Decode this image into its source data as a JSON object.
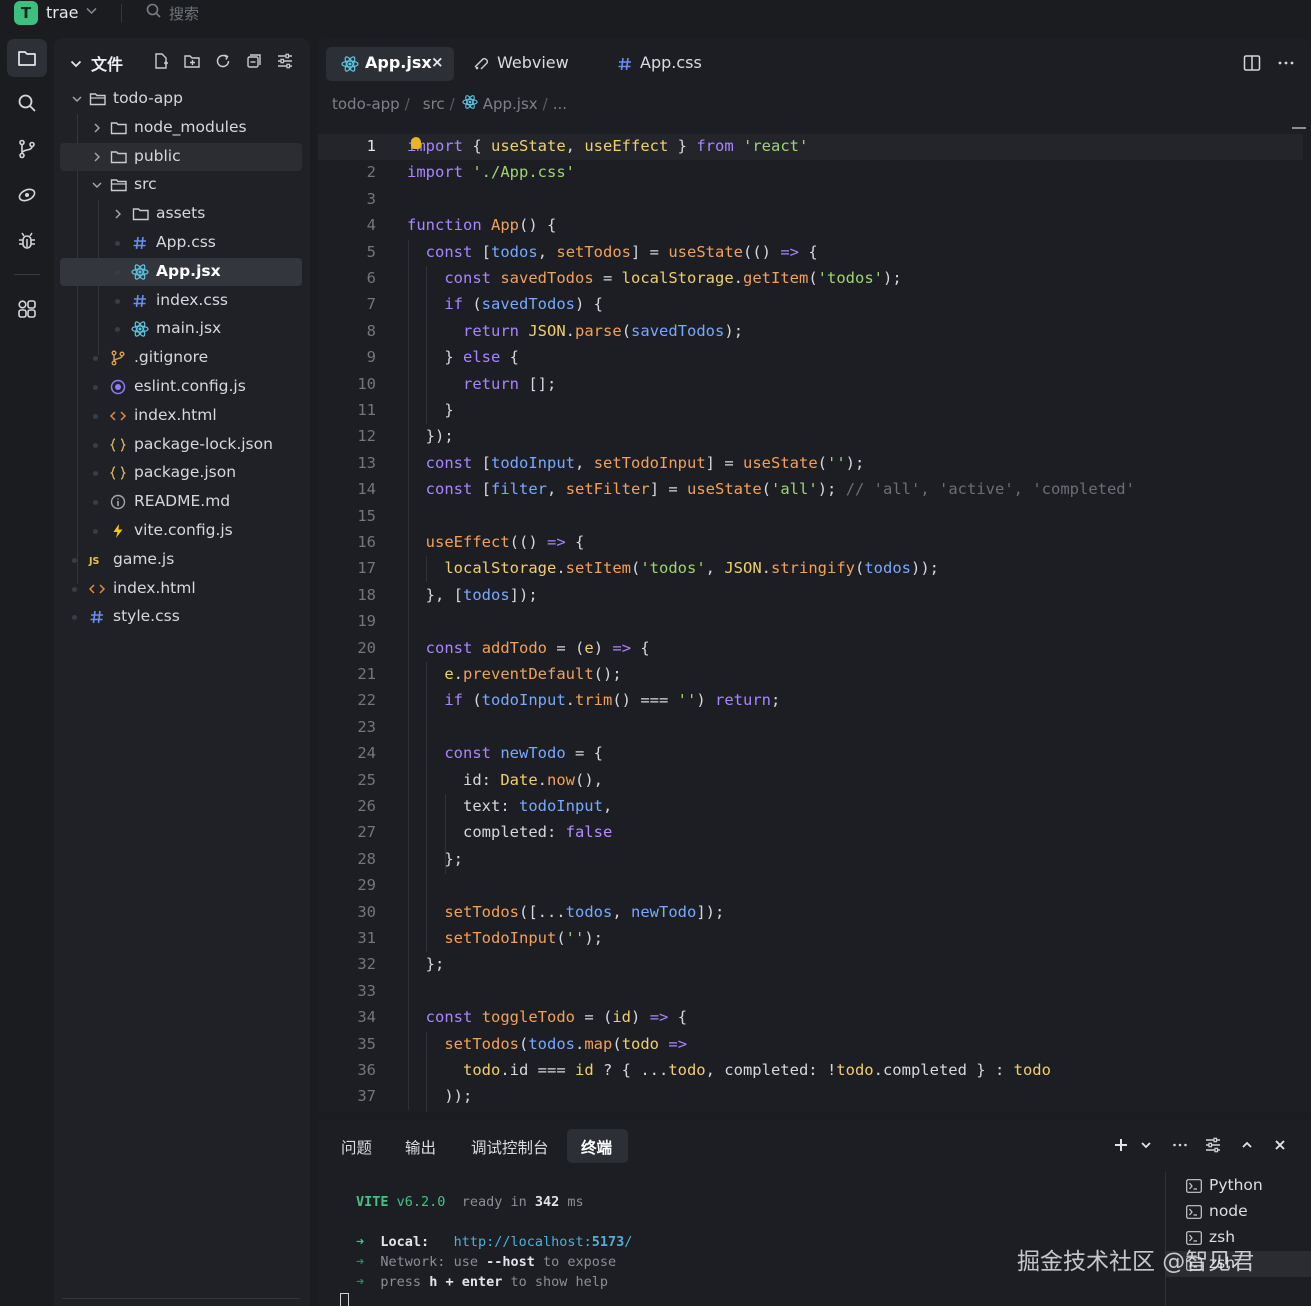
{
  "app": {
    "logo_letter": "T",
    "name": "trae",
    "search_placeholder": "搜索"
  },
  "explorer": {
    "title": "文件",
    "tree": [
      {
        "label": "todo-app",
        "icon": "folder-open-icon"
      },
      {
        "label": "node_modules",
        "icon": "folder-icon"
      },
      {
        "label": "public",
        "icon": "folder-icon"
      },
      {
        "label": "src",
        "icon": "folder-open-icon"
      },
      {
        "label": "assets",
        "icon": "folder-icon"
      },
      {
        "label": "App.css",
        "icon": "css-hash-icon"
      },
      {
        "label": "App.jsx",
        "icon": "react-icon"
      },
      {
        "label": "index.css",
        "icon": "css-hash-icon"
      },
      {
        "label": "main.jsx",
        "icon": "react-icon"
      },
      {
        "label": ".gitignore",
        "icon": "git-icon"
      },
      {
        "label": "eslint.config.js",
        "icon": "eslint-icon"
      },
      {
        "label": "index.html",
        "icon": "html-icon"
      },
      {
        "label": "package-lock.json",
        "icon": "json-icon"
      },
      {
        "label": "package.json",
        "icon": "json-icon"
      },
      {
        "label": "README.md",
        "icon": "info-icon"
      },
      {
        "label": "vite.config.js",
        "icon": "vite-icon"
      },
      {
        "label": "game.js",
        "icon": "js-icon"
      },
      {
        "label": "index.html",
        "icon": "html-icon"
      },
      {
        "label": "style.css",
        "icon": "css-hash-icon"
      }
    ]
  },
  "editor": {
    "tabs": [
      {
        "label": "App.jsx",
        "icon": "react-icon",
        "active": true,
        "close": "×"
      },
      {
        "label": "Webview",
        "icon": "webview-icon"
      },
      {
        "label": "App.css",
        "icon": "css-hash-icon"
      }
    ],
    "breadcrumb": {
      "part1": "todo-app",
      "part2": "src",
      "part3": "App.jsx",
      "sep": "/",
      "more": "..."
    },
    "line_numbers": [
      "1",
      "2",
      "3",
      "4",
      "5",
      "6",
      "7",
      "8",
      "9",
      "10",
      "11",
      "12",
      "13",
      "14",
      "15",
      "16",
      "17",
      "18",
      "19",
      "20",
      "21",
      "22",
      "23",
      "24",
      "25",
      "26",
      "27",
      "28",
      "29",
      "30",
      "31",
      "32",
      "33",
      "34",
      "35",
      "36",
      "37"
    ],
    "code_lines": [
      [
        [
          "k",
          "import"
        ],
        [
          "p",
          " { "
        ],
        [
          "y",
          "useState"
        ],
        [
          "p",
          ", "
        ],
        [
          "y",
          "useEffect"
        ],
        [
          "p",
          " } "
        ],
        [
          "k",
          "from"
        ],
        [
          "p",
          " "
        ],
        [
          "s",
          "'react'"
        ]
      ],
      [
        [
          "k",
          "import"
        ],
        [
          "p",
          " "
        ],
        [
          "s",
          "'./App.css'"
        ]
      ],
      [],
      [
        [
          "k",
          "function"
        ],
        [
          "p",
          " "
        ],
        [
          "f",
          "App"
        ],
        [
          "p",
          "() {"
        ]
      ],
      [
        [
          "p",
          "  "
        ],
        [
          "k",
          "const"
        ],
        [
          "p",
          " ["
        ],
        [
          "v",
          "todos"
        ],
        [
          "p",
          ", "
        ],
        [
          "f",
          "setTodos"
        ],
        [
          "p",
          "] = "
        ],
        [
          "f",
          "useState"
        ],
        [
          "p",
          "(() "
        ],
        [
          "k",
          "=>"
        ],
        [
          "p",
          " {"
        ]
      ],
      [
        [
          "p",
          "    "
        ],
        [
          "k",
          "const"
        ],
        [
          "p",
          " "
        ],
        [
          "f",
          "savedTodos"
        ],
        [
          "p",
          " = "
        ],
        [
          "y",
          "localStorage"
        ],
        [
          "p",
          "."
        ],
        [
          "f",
          "getItem"
        ],
        [
          "p",
          "("
        ],
        [
          "s",
          "'todos'"
        ],
        [
          "p",
          ");"
        ]
      ],
      [
        [
          "p",
          "    "
        ],
        [
          "k",
          "if"
        ],
        [
          "p",
          " ("
        ],
        [
          "v",
          "savedTodos"
        ],
        [
          "p",
          ") {"
        ]
      ],
      [
        [
          "p",
          "      "
        ],
        [
          "k",
          "return"
        ],
        [
          "p",
          " "
        ],
        [
          "y",
          "JSON"
        ],
        [
          "p",
          "."
        ],
        [
          "f",
          "parse"
        ],
        [
          "p",
          "("
        ],
        [
          "v",
          "savedTodos"
        ],
        [
          "p",
          ");"
        ]
      ],
      [
        [
          "p",
          "    } "
        ],
        [
          "k",
          "else"
        ],
        [
          "p",
          " {"
        ]
      ],
      [
        [
          "p",
          "      "
        ],
        [
          "k",
          "return"
        ],
        [
          "p",
          " [];"
        ]
      ],
      [
        [
          "p",
          "    }"
        ]
      ],
      [
        [
          "p",
          "  });"
        ]
      ],
      [
        [
          "p",
          "  "
        ],
        [
          "k",
          "const"
        ],
        [
          "p",
          " ["
        ],
        [
          "v",
          "todoInput"
        ],
        [
          "p",
          ", "
        ],
        [
          "f",
          "setTodoInput"
        ],
        [
          "p",
          "] = "
        ],
        [
          "f",
          "useState"
        ],
        [
          "p",
          "("
        ],
        [
          "s",
          "''"
        ],
        [
          "p",
          ");"
        ]
      ],
      [
        [
          "p",
          "  "
        ],
        [
          "k",
          "const"
        ],
        [
          "p",
          " ["
        ],
        [
          "v",
          "filter"
        ],
        [
          "p",
          ", "
        ],
        [
          "f",
          "setFilter"
        ],
        [
          "p",
          "] = "
        ],
        [
          "f",
          "useState"
        ],
        [
          "p",
          "("
        ],
        [
          "s",
          "'all'"
        ],
        [
          "p",
          "); "
        ],
        [
          "c",
          "// 'all', 'active', 'completed'"
        ]
      ],
      [],
      [
        [
          "p",
          "  "
        ],
        [
          "f",
          "useEffect"
        ],
        [
          "p",
          "(() "
        ],
        [
          "k",
          "=>"
        ],
        [
          "p",
          " {"
        ]
      ],
      [
        [
          "p",
          "    "
        ],
        [
          "y",
          "localStorage"
        ],
        [
          "p",
          "."
        ],
        [
          "f",
          "setItem"
        ],
        [
          "p",
          "("
        ],
        [
          "s",
          "'todos'"
        ],
        [
          "p",
          ", "
        ],
        [
          "y",
          "JSON"
        ],
        [
          "p",
          "."
        ],
        [
          "f",
          "stringify"
        ],
        [
          "p",
          "("
        ],
        [
          "v",
          "todos"
        ],
        [
          "p",
          "));"
        ]
      ],
      [
        [
          "p",
          "  }, ["
        ],
        [
          "v",
          "todos"
        ],
        [
          "p",
          "]);"
        ]
      ],
      [],
      [
        [
          "p",
          "  "
        ],
        [
          "k",
          "const"
        ],
        [
          "p",
          " "
        ],
        [
          "f",
          "addTodo"
        ],
        [
          "p",
          " = ("
        ],
        [
          "y",
          "e"
        ],
        [
          "p",
          ") "
        ],
        [
          "k",
          "=>"
        ],
        [
          "p",
          " {"
        ]
      ],
      [
        [
          "p",
          "    "
        ],
        [
          "y",
          "e"
        ],
        [
          "p",
          "."
        ],
        [
          "f",
          "preventDefault"
        ],
        [
          "p",
          "();"
        ]
      ],
      [
        [
          "p",
          "    "
        ],
        [
          "k",
          "if"
        ],
        [
          "p",
          " ("
        ],
        [
          "v",
          "todoInput"
        ],
        [
          "p",
          "."
        ],
        [
          "f",
          "trim"
        ],
        [
          "p",
          "() === "
        ],
        [
          "s",
          "''"
        ],
        [
          "p",
          ") "
        ],
        [
          "k",
          "return"
        ],
        [
          "p",
          ";"
        ]
      ],
      [],
      [
        [
          "p",
          "    "
        ],
        [
          "k",
          "const"
        ],
        [
          "p",
          " "
        ],
        [
          "v",
          "newTodo"
        ],
        [
          "p",
          " = {"
        ]
      ],
      [
        [
          "p",
          "      id: "
        ],
        [
          "y",
          "Date"
        ],
        [
          "p",
          "."
        ],
        [
          "f",
          "now"
        ],
        [
          "p",
          "(),"
        ]
      ],
      [
        [
          "p",
          "      text: "
        ],
        [
          "v",
          "todoInput"
        ],
        [
          "p",
          ","
        ]
      ],
      [
        [
          "p",
          "      completed: "
        ],
        [
          "b",
          "false"
        ]
      ],
      [
        [
          "p",
          "    };"
        ]
      ],
      [],
      [
        [
          "p",
          "    "
        ],
        [
          "f",
          "setTodos"
        ],
        [
          "p",
          "([..."
        ],
        [
          "v",
          "todos"
        ],
        [
          "p",
          ", "
        ],
        [
          "v",
          "newTodo"
        ],
        [
          "p",
          "]);"
        ]
      ],
      [
        [
          "p",
          "    "
        ],
        [
          "f",
          "setTodoInput"
        ],
        [
          "p",
          "("
        ],
        [
          "s",
          "''"
        ],
        [
          "p",
          ");"
        ]
      ],
      [
        [
          "p",
          "  };"
        ]
      ],
      [],
      [
        [
          "p",
          "  "
        ],
        [
          "k",
          "const"
        ],
        [
          "p",
          " "
        ],
        [
          "f",
          "toggleTodo"
        ],
        [
          "p",
          " = ("
        ],
        [
          "y",
          "id"
        ],
        [
          "p",
          ") "
        ],
        [
          "k",
          "=>"
        ],
        [
          "p",
          " {"
        ]
      ],
      [
        [
          "p",
          "    "
        ],
        [
          "f",
          "setTodos"
        ],
        [
          "p",
          "("
        ],
        [
          "v",
          "todos"
        ],
        [
          "p",
          "."
        ],
        [
          "f",
          "map"
        ],
        [
          "p",
          "("
        ],
        [
          "y",
          "todo"
        ],
        [
          "p",
          " "
        ],
        [
          "k",
          "=>"
        ]
      ],
      [
        [
          "p",
          "      "
        ],
        [
          "y",
          "todo"
        ],
        [
          "p",
          ".id === "
        ],
        [
          "y",
          "id"
        ],
        [
          "p",
          " ? { ..."
        ],
        [
          "y",
          "todo"
        ],
        [
          "p",
          ", completed: !"
        ],
        [
          "y",
          "todo"
        ],
        [
          "p",
          ".completed } : "
        ],
        [
          "y",
          "todo"
        ]
      ],
      [
        [
          "p",
          "    ));"
        ]
      ]
    ]
  },
  "panel": {
    "tabs": [
      "问题",
      "输出",
      "调试控制台",
      "终端"
    ],
    "active_tab": "终端",
    "terminal": {
      "vite": "VITE",
      "version": "v6.2.0",
      "ready": "ready in",
      "ms_value": "342",
      "ms": "ms",
      "arrow": "➜",
      "local_label": "Local:",
      "local_url_a": "http://localhost:",
      "local_port": "5173",
      "local_url_b": "/",
      "network_label": "Network:",
      "network_a": "use",
      "network_flag": "--host",
      "network_b": "to expose",
      "help_a": "press",
      "help_h": "h",
      "help_plus": "+",
      "help_enter": "enter",
      "help_b": "to show help"
    },
    "terminals": [
      "Python",
      "node",
      "zsh",
      "zsh"
    ]
  },
  "watermark": "掘金技术社区 @智见君"
}
